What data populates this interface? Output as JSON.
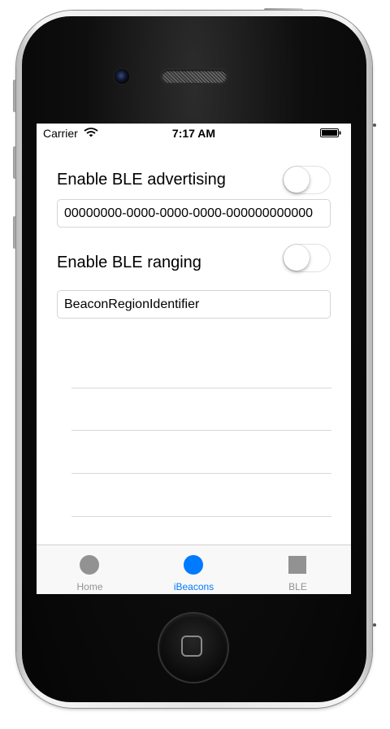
{
  "status_bar": {
    "carrier": "Carrier",
    "time": "7:17 AM"
  },
  "advertising": {
    "label": "Enable BLE advertising",
    "enabled": false,
    "uuid_value": "00000000-0000-0000-0000-000000000000"
  },
  "ranging": {
    "label": "Enable BLE ranging",
    "enabled": false,
    "region_identifier_value": "BeaconRegionIdentifier"
  },
  "beacon_rows": [
    {
      "text": ""
    },
    {
      "text": ""
    },
    {
      "text": ""
    },
    {
      "text": ""
    }
  ],
  "tab_bar": {
    "selected": "iBeacons",
    "tabs": [
      {
        "label": "Home",
        "icon": "circle-icon",
        "selected": false
      },
      {
        "label": "iBeacons",
        "icon": "circle-icon",
        "selected": true
      },
      {
        "label": "BLE",
        "icon": "square-icon",
        "selected": false
      }
    ]
  },
  "colors": {
    "accent": "#007aff",
    "tab_inactive": "#929292",
    "background": "#ffffff"
  }
}
